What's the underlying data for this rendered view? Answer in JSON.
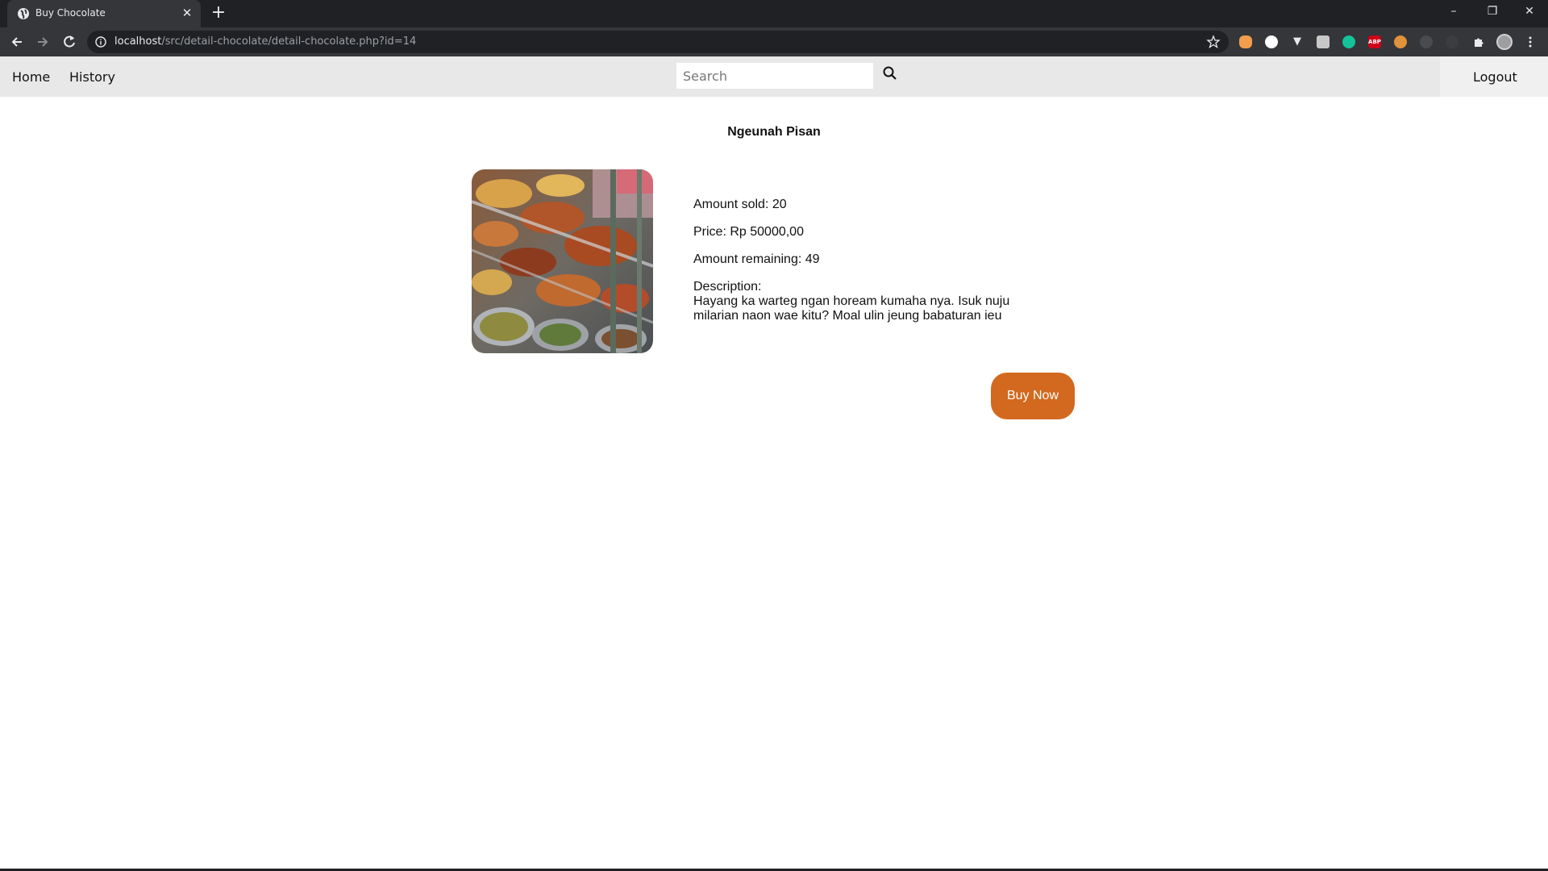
{
  "browser": {
    "tab_title": "Buy Chocolate",
    "url_host": "localhost",
    "url_path": "/src/detail-chocolate/detail-chocolate.php?id=14",
    "extensions": [
      "",
      "",
      "",
      "",
      "",
      "ABP",
      "",
      "",
      ""
    ]
  },
  "navbar": {
    "home": "Home",
    "history": "History",
    "search_placeholder": "Search",
    "logout": "Logout"
  },
  "product": {
    "name": "Ngeunah Pisan",
    "amount_sold": "Amount sold: 20",
    "price": "Price: Rp 50000,00",
    "amount_remaining": "Amount remaining: 49",
    "description_label": "Description:",
    "description": "Hayang ka warteg ngan hoream kumaha nya. Isuk nuju milarian naon wae kitu? Moal ulin jeung babaturan ieu",
    "buy_label": "Buy Now"
  },
  "colors": {
    "accent": "#d2691e",
    "navbar_bg": "#e8e8e8"
  }
}
